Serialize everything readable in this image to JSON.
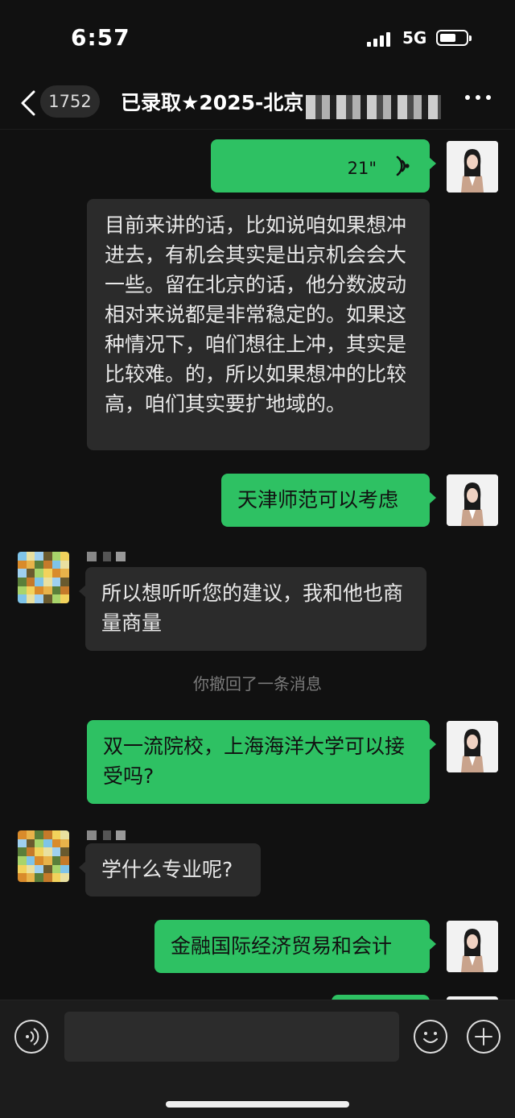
{
  "status_bar": {
    "time": "6:57",
    "network": "5G"
  },
  "nav": {
    "unread_count": "1752",
    "title": "已录取★2025-北京"
  },
  "messages": {
    "m1": {
      "duration": "21\""
    },
    "m2": {
      "text": "目前来讲的话，比如说咱如果想冲进去，有机会其实是出京机会会大一些。留在北京的话，他分数波动相对来说都是非常稳定的。如果这种情况下，咱们想往上冲，其实是比较难。的，所以如果想冲的比较高，咱们其实要扩地域的。"
    },
    "m3": {
      "text": "天津师范可以考虑"
    },
    "m4": {
      "text": "所以想听听您的建议，我和他也商量商量"
    },
    "system": {
      "text": "你撤回了一条消息"
    },
    "m5": {
      "text": "双一流院校，上海海洋大学可以接受吗?"
    },
    "m6": {
      "text": "学什么专业呢?"
    },
    "m7": {
      "text": "金融国际经济贸易和会计"
    }
  },
  "colors": {
    "self_bubble": "#2ec163",
    "other_bubble": "#2b2b2b",
    "background": "#111111"
  },
  "icons": [
    "back-chevron-icon",
    "more-icon",
    "voice-wave-icon",
    "voice-input-icon",
    "emoji-icon",
    "add-icon"
  ]
}
